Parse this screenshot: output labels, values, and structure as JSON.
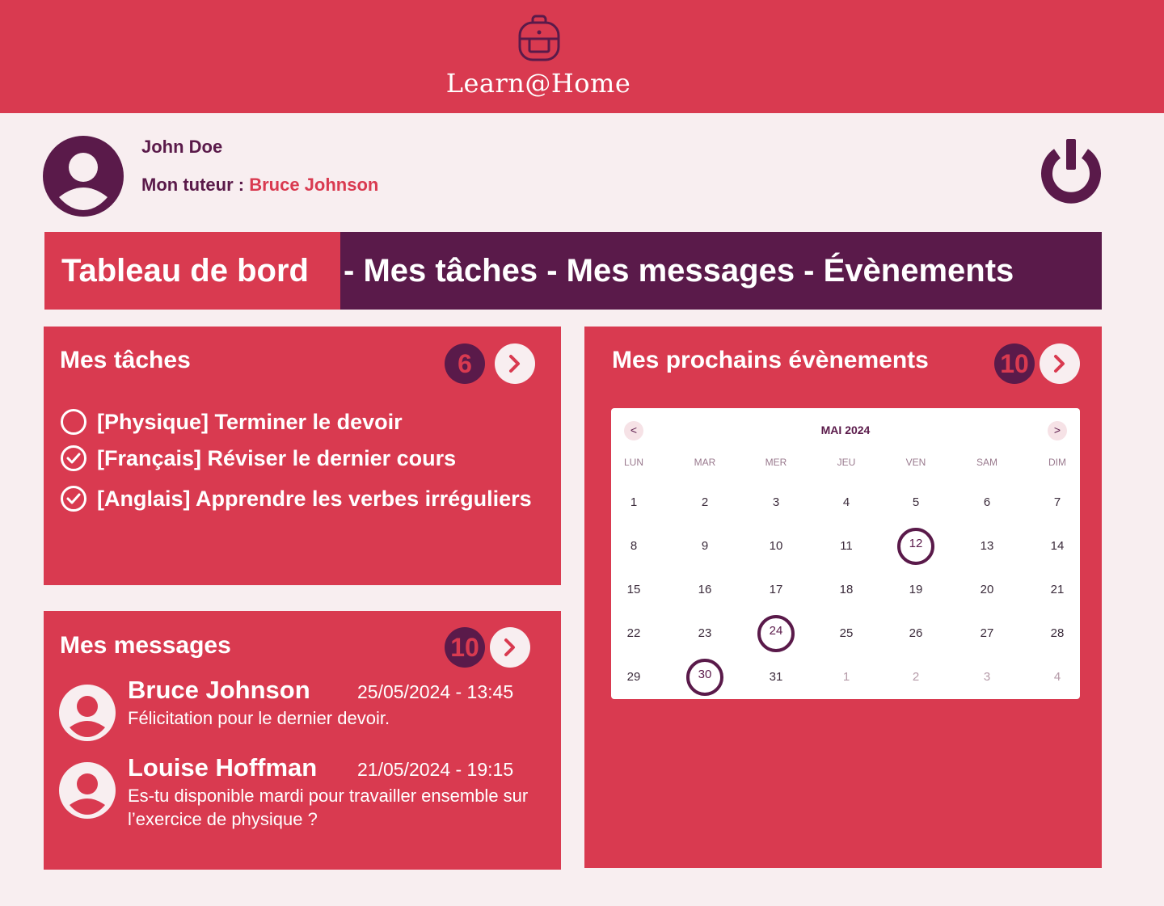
{
  "app": {
    "title": "Learn@Home",
    "logo_icon": "backpack-icon"
  },
  "user": {
    "name": "John Doe",
    "tutor_label": "Mon tuteur : ",
    "tutor_name": "Bruce Johnson"
  },
  "nav": {
    "active": "Tableau de bord",
    "items": [
      "Mes tâches",
      "Mes messages",
      "Évènements"
    ],
    "separator": " - "
  },
  "tasks": {
    "title": "Mes tâches",
    "count": "6",
    "items": [
      {
        "label": "[Physique] Terminer le devoir",
        "done": false
      },
      {
        "label": "[Français] Réviser le dernier cours",
        "done": true
      },
      {
        "label": "[Anglais] Apprendre les verbes irréguliers",
        "done": true
      }
    ]
  },
  "messages": {
    "title": "Mes messages",
    "count": "10",
    "items": [
      {
        "sender": "Bruce Johnson",
        "date": "25/05/2024 - 13:45",
        "text": "Félicitation pour le dernier devoir."
      },
      {
        "sender": "Louise Hoffman",
        "date": "21/05/2024 - 19:15",
        "text": "Es-tu disponible mardi pour travailler ensemble sur l’exercice de physique ?"
      }
    ]
  },
  "events": {
    "title": "Mes prochains évènements",
    "count": "10",
    "calendar": {
      "month": "MAI 2024",
      "prev": "<",
      "next": ">",
      "weekdays": [
        "LUN",
        "MAR",
        "MER",
        "JEU",
        "VEN",
        "SAM",
        "DIM"
      ],
      "weeks": [
        [
          "1",
          "2",
          "3",
          "4",
          "5",
          "6",
          "7"
        ],
        [
          "8",
          "9",
          "10",
          "11",
          "12",
          "13",
          "14"
        ],
        [
          "15",
          "16",
          "17",
          "18",
          "19",
          "20",
          "21"
        ],
        [
          "22",
          "23",
          "24",
          "25",
          "26",
          "27",
          "28"
        ],
        [
          "29",
          "30",
          "31",
          "1",
          "2",
          "3",
          "4"
        ]
      ],
      "event_days": [
        "12",
        "24",
        "30"
      ],
      "next_month_days_from_index": 3
    }
  },
  "colors": {
    "primary": "#d93a50",
    "secondary": "#5a1a4a",
    "background": "#f8eef0"
  }
}
